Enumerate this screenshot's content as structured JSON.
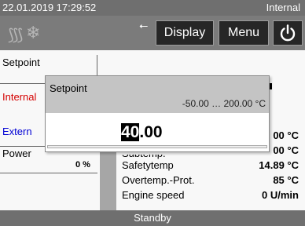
{
  "status": {
    "datetime": "22.01.2019 17:29:52",
    "mode": "Internal"
  },
  "toolbar": {
    "icons": [
      "heating-icon",
      "cooling-icon",
      "usb-icon"
    ],
    "display_label": "Display",
    "menu_label": "Menu",
    "power_icon": "power-icon"
  },
  "left_panel": {
    "setpoint_label": "Setpoint",
    "internal_label": "Internal",
    "external_label": "Extern",
    "power_label": "Power",
    "power_value": "0 %"
  },
  "measurements": {
    "row0_value": "00 °C",
    "row1_partial_label": "Subtemp.",
    "row1_value": "00 °C",
    "rows": [
      {
        "label": "Safetytemp",
        "value": "14.89 °C"
      },
      {
        "label": "Overtemp.-Prot.",
        "value": "85 °C"
      },
      {
        "label": "Engine speed",
        "value": "0 U/min"
      }
    ]
  },
  "footer": {
    "status": "Standby"
  },
  "dialog": {
    "title": "Setpoint",
    "range": "-50.00 … 200.00 °C",
    "value_highlight": "40",
    "value_rest": ".00"
  },
  "colors": {
    "internal": "#d40000",
    "external": "#0000d4",
    "bar": "#6f6f6f"
  }
}
